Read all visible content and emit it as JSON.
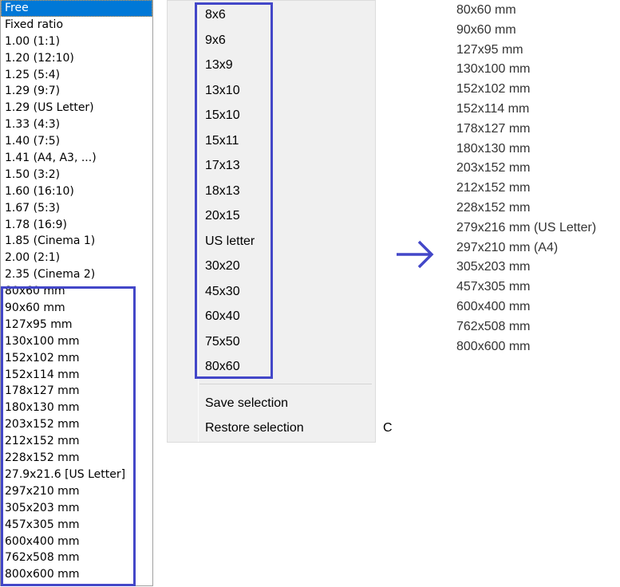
{
  "listbox": {
    "items": [
      "Free",
      "Fixed ratio",
      "1.00 (1:1)",
      "1.20 (12:10)",
      "1.25 (5:4)",
      "1.29 (9:7)",
      "1.29 (US Letter)",
      "1.33 (4:3)",
      "1.40 (7:5)",
      "1.41 (A4, A3, ...)",
      "1.50 (3:2)",
      "1.60 (16:10)",
      "1.67 (5:3)",
      "1.78 (16:9)",
      "1.85 (Cinema 1)",
      "2.00 (2:1)",
      "2.35 (Cinema 2)",
      "80x60 mm",
      "90x60 mm",
      "127x95 mm",
      "130x100 mm",
      "152x102 mm",
      "152x114 mm",
      "178x127 mm",
      "180x130 mm",
      "203x152 mm",
      "212x152 mm",
      "228x152 mm",
      "27.9x21.6 [US Letter]",
      "297x210 mm",
      "305x203 mm",
      "457x305 mm",
      "600x400 mm",
      "762x508 mm",
      "800x600 mm"
    ],
    "selected": "Free"
  },
  "menu": {
    "items": [
      "8x6",
      "9x6",
      "13x9",
      "13x10",
      "15x10",
      "15x11",
      "17x13",
      "18x13",
      "20x15",
      "US letter",
      "30x20",
      "45x30",
      "60x40",
      "75x50",
      "80x60"
    ],
    "save": "Save selection",
    "restore": "Restore selection",
    "restore_shortcut": "C"
  },
  "proposed": {
    "items": [
      "80x60 mm",
      "90x60 mm",
      "127x95 mm",
      "130x100 mm",
      "152x102 mm",
      "152x114 mm",
      "178x127 mm",
      "180x130 mm",
      "203x152 mm",
      "212x152 mm",
      "228x152 mm",
      "279x216 mm (US Letter)",
      "297x210 mm (A4)",
      "305x203 mm",
      "457x305 mm",
      "600x400 mm",
      "762x508 mm",
      "800x600 mm"
    ]
  },
  "colors": {
    "highlight": "#4347c8",
    "selection": "#0078d7"
  },
  "icons": {
    "arrow": "arrow-right-icon"
  }
}
